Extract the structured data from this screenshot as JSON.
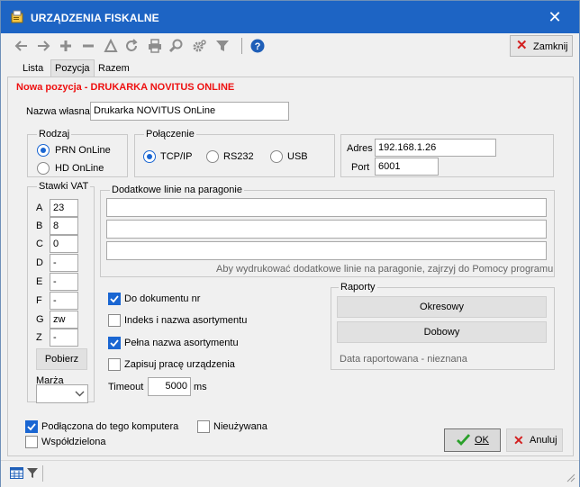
{
  "window": {
    "title": "URZĄDZENIA FISKALNE",
    "close_glyph": "✕"
  },
  "toolbar": {
    "icons": [
      "arrow-left-icon",
      "arrow-right-icon",
      "plus-icon",
      "minus-icon",
      "triangle-icon",
      "refresh-icon",
      "printer-icon",
      "search-icon",
      "gear-icon",
      "filter-icon",
      "help-icon"
    ],
    "close_label": "Zamknij"
  },
  "tabs": [
    {
      "label": "Lista"
    },
    {
      "label": "Pozycja"
    },
    {
      "label": "Razem"
    }
  ],
  "form": {
    "legend": "Nowa pozycja - DRUKARKA NOVITUS ONLINE",
    "name_label": "Nazwa własna",
    "name_value": "Drukarka NOVITUS OnLine",
    "rodzaj": {
      "title": "Rodzaj",
      "options": [
        "PRN OnLine",
        "HD OnLine"
      ],
      "selected": "PRN OnLine"
    },
    "polaczenie": {
      "title": "Połączenie",
      "options": [
        "TCP/IP",
        "RS232",
        "USB"
      ],
      "selected": "TCP/IP"
    },
    "adres_label": "Adres",
    "adres_value": "192.168.1.26",
    "port_label": "Port",
    "port_value": "6001",
    "vat": {
      "title": "Stawki VAT",
      "rows": [
        {
          "letter": "A",
          "value": "23"
        },
        {
          "letter": "B",
          "value": "8"
        },
        {
          "letter": "C",
          "value": "0"
        },
        {
          "letter": "D",
          "value": "-"
        },
        {
          "letter": "E",
          "value": "-"
        },
        {
          "letter": "F",
          "value": "-"
        },
        {
          "letter": "G",
          "value": "zw"
        },
        {
          "letter": "Z",
          "value": "-"
        }
      ],
      "fetch_button": "Pobierz"
    },
    "marza_label": "Marża",
    "extra_lines": {
      "title": "Dodatkowe linie na paragonie",
      "values": [
        "",
        "",
        ""
      ],
      "hint": "Aby wydrukować dodatkowe linie na paragonie, zajrzyj do Pomocy programu"
    },
    "checks": [
      {
        "label": "Do dokumentu nr",
        "checked": true
      },
      {
        "label": "Indeks i nazwa asortymentu",
        "checked": false
      },
      {
        "label": "Pełna nazwa asortymentu",
        "checked": true
      },
      {
        "label": "Zapisuj pracę urządzenia",
        "checked": false
      }
    ],
    "timeout_label": "Timeout",
    "timeout_value": "5000",
    "timeout_unit": "ms",
    "raporty": {
      "title": "Raporty",
      "periodic_button": "Okresowy",
      "daily_button": "Dobowy",
      "status": "Data raportowana  - nieznana"
    },
    "connected": {
      "label": "Podłączona do tego komputera",
      "checked": true
    },
    "unused": {
      "label": "Nieużywana",
      "checked": false
    },
    "shared": {
      "label": "Współdzielona",
      "checked": false
    }
  },
  "buttons": {
    "ok": "OK",
    "cancel": "Anuluj"
  },
  "colors": {
    "title_bar": "#1d64c4",
    "accent": "#1a66d2",
    "legend": "#ee1111",
    "ok_check": "#2aa02a",
    "cancel_x": "#d32020"
  }
}
